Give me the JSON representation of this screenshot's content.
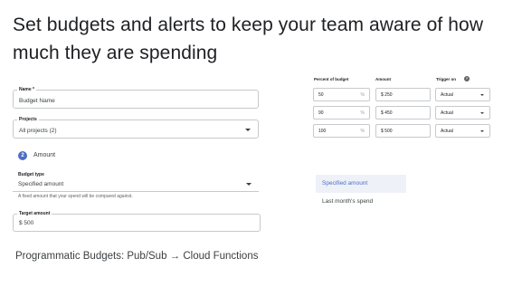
{
  "headline": "Set budgets and alerts to keep your team aware of how much they are spending",
  "form": {
    "name": {
      "label": "Name *",
      "value": "Budget Name"
    },
    "projects": {
      "label": "Projects",
      "value": "All projects (2)",
      "icon": "caret-down-icon"
    },
    "step": {
      "number": "2",
      "label": "Amount",
      "color": "#4d6ec5"
    },
    "budget_type": {
      "label": "Budget type",
      "value": "Specified amount",
      "icon": "caret-down-icon"
    },
    "hint": "A fixed amount that your spend will be compared against.",
    "target_amount": {
      "label": "Target amount",
      "value": "$ 500"
    }
  },
  "thresholds": {
    "headers": {
      "percent": "Percent of budget",
      "amount": "Amount",
      "trigger": "Trigger on"
    },
    "help_icon": "help-icon",
    "rows": [
      {
        "percent": "50",
        "percent_unit": "%",
        "amount": "$ 250",
        "trigger": "Actual"
      },
      {
        "percent": "90",
        "percent_unit": "%",
        "amount": "$ 450",
        "trigger": "Actual"
      },
      {
        "percent": "100",
        "percent_unit": "%",
        "amount": "$ 500",
        "trigger": "Actual"
      }
    ]
  },
  "budget_type_menu": {
    "items": [
      {
        "label": "Specified amount",
        "selected": true
      },
      {
        "label": "Last month's spend",
        "selected": false
      }
    ],
    "accent": "#4d6ec5"
  },
  "footer": "Programmatic Budgets: Pub/Sub → Cloud Functions"
}
